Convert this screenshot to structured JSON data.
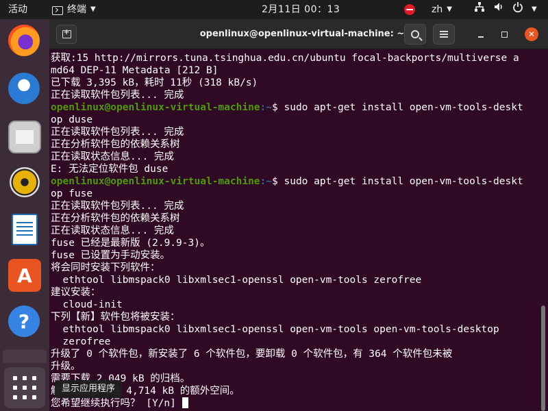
{
  "topbar": {
    "activities": "活动",
    "app_name": "终端",
    "clock": "2月11日  00：13",
    "lang": "zh"
  },
  "dock": {
    "items": [
      "firefox-icon",
      "thunderbird-icon",
      "files-icon",
      "rhythmbox-icon",
      "libreoffice-writer-icon",
      "software-center-icon",
      "help-icon"
    ],
    "tooltip": "显示应用程序"
  },
  "window": {
    "title": "openlinux@openlinux-virtual-machine: ~"
  },
  "terminal": {
    "prompt_user": "openlinux@openlinux-virtual-machine",
    "prompt_path": ":~",
    "prompt_dollar": "$ ",
    "cmd1": "sudo apt-get install open-vm-tools-deskt",
    "cmd2": "sudo apt-get install open-vm-tools-deskt",
    "lines": [
      "获取:15 http://mirrors.tuna.tsinghua.edu.cn/ubuntu focal-backports/multiverse a",
      "md64 DEP-11 Metadata [212 B]",
      "已下载 3,395 kB，耗时 11秒 (318 kB/s)",
      "正在读取软件包列表... 完成",
      "op duse",
      "正在读取软件包列表... 完成",
      "正在分析软件包的依赖关系树",
      "正在读取状态信息... 完成",
      "E: 无法定位软件包 duse",
      "op fuse",
      "正在读取软件包列表... 完成",
      "正在分析软件包的依赖关系树",
      "正在读取状态信息... 完成",
      "fuse 已经是最新版 (2.9.9-3)。",
      "fuse 已设置为手动安装。",
      "将会同时安装下列软件：",
      "  ethtool libmspack0 libxmlsec1-openssl open-vm-tools zerofree",
      "建议安装：",
      "  cloud-init",
      "下列【新】软件包将被安装：",
      "  ethtool libmspack0 libxmlsec1-openssl open-vm-tools open-vm-tools-desktop",
      "  zerofree",
      "升级了 0 个软件包，新安装了 6 个软件包，要卸载 0 个软件包，有 364 个软件包未被",
      "升级。",
      "需要下载 2,049 kB 的归档。",
      "解压缩后会消耗 4,714 kB 的额外空间。",
      "您希望继续执行吗？ [Y/n] "
    ]
  }
}
